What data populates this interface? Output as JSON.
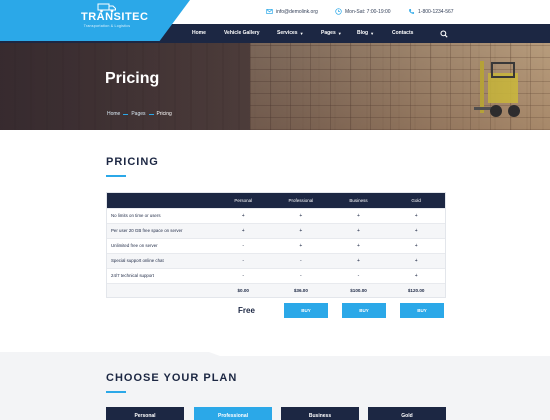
{
  "brand": {
    "name": "TRANSITEC",
    "tagline": "Transportation & Logistics",
    "accent": "#2ba8e8",
    "navy": "#1c2743"
  },
  "topbar": {
    "email": "info@demolink.org",
    "hours": "Mon-Sat: 7:00-19:00",
    "phone": "1-800-1234-567",
    "email_icon": "envelope-icon",
    "hours_icon": "clock-icon",
    "phone_icon": "phone-icon"
  },
  "nav": {
    "items": [
      {
        "label": "Home"
      },
      {
        "label": "Vehicle Gallery"
      },
      {
        "label": "Services"
      },
      {
        "label": "Pages"
      },
      {
        "label": "Blog"
      },
      {
        "label": "Contacts"
      }
    ],
    "search_icon": "search-icon"
  },
  "hero": {
    "title": "Pricing",
    "breadcrumb": [
      "Home",
      "Pages",
      "Pricing"
    ]
  },
  "pricing": {
    "title": "PRICING",
    "columns": [
      "",
      "Personal",
      "Professional",
      "Business",
      "Gold"
    ],
    "rows": [
      {
        "feature": "No limits on time or users",
        "values": [
          "+",
          "+",
          "+",
          "+"
        ]
      },
      {
        "feature": "Per user 20 GB free space on server",
        "values": [
          "+",
          "+",
          "+",
          "+"
        ]
      },
      {
        "feature": "Unlimited free on server",
        "values": [
          "-",
          "+",
          "+",
          "+"
        ]
      },
      {
        "feature": "Special support online chat",
        "values": [
          "-",
          "-",
          "+",
          "+"
        ]
      },
      {
        "feature": "24/7 technical support",
        "values": [
          "-",
          "-",
          "-",
          "+"
        ]
      }
    ],
    "prices": [
      "$0.00",
      "$36.00",
      "$100.00",
      "$120.00"
    ],
    "free_label": "Free",
    "buy_label": "BUY"
  },
  "plans": {
    "title": "CHOOSE YOUR PLAN",
    "cards": [
      "Personal",
      "Professional",
      "Business",
      "Gold"
    ]
  }
}
